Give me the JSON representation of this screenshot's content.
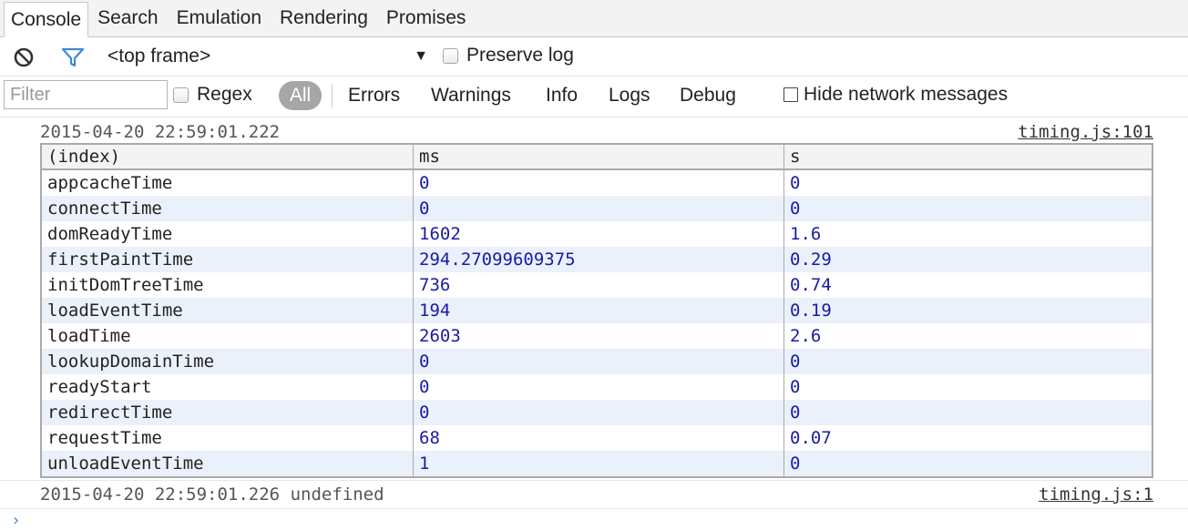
{
  "tabs": [
    "Console",
    "Search",
    "Emulation",
    "Rendering",
    "Promises"
  ],
  "toolbar": {
    "frame": "<top frame>",
    "frame_arrow": "▼",
    "preserve_log": "Preserve log"
  },
  "filterbar": {
    "filter_placeholder": "Filter",
    "regex": "Regex",
    "levels": [
      "All",
      "Errors",
      "Warnings",
      "Info",
      "Logs",
      "Debug"
    ],
    "hide_network": "Hide network messages"
  },
  "messages": [
    {
      "timestamp": "2015-04-20 22:59:01.222",
      "text": "",
      "source": "timing.js:101"
    },
    {
      "timestamp": "2015-04-20 22:59:01.226",
      "text": "undefined",
      "source": "timing.js:1"
    }
  ],
  "table": {
    "headers": [
      "(index)",
      "ms",
      "s"
    ],
    "rows": [
      [
        "appcacheTime",
        "0",
        "0"
      ],
      [
        "connectTime",
        "0",
        "0"
      ],
      [
        "domReadyTime",
        "1602",
        "1.6"
      ],
      [
        "firstPaintTime",
        "294.27099609375",
        "0.29"
      ],
      [
        "initDomTreeTime",
        "736",
        "0.74"
      ],
      [
        "loadEventTime",
        "194",
        "0.19"
      ],
      [
        "loadTime",
        "2603",
        "2.6"
      ],
      [
        "lookupDomainTime",
        "0",
        "0"
      ],
      [
        "readyStart",
        "0",
        "0"
      ],
      [
        "redirectTime",
        "0",
        "0"
      ],
      [
        "requestTime",
        "68",
        "0.07"
      ],
      [
        "unloadEventTime",
        "1",
        "0"
      ]
    ]
  },
  "prompt_symbol": "›",
  "colors": {
    "number": "#1a1aa6",
    "alt_row": "#eaf1fb",
    "filter_icon": "#3b8ad9"
  }
}
